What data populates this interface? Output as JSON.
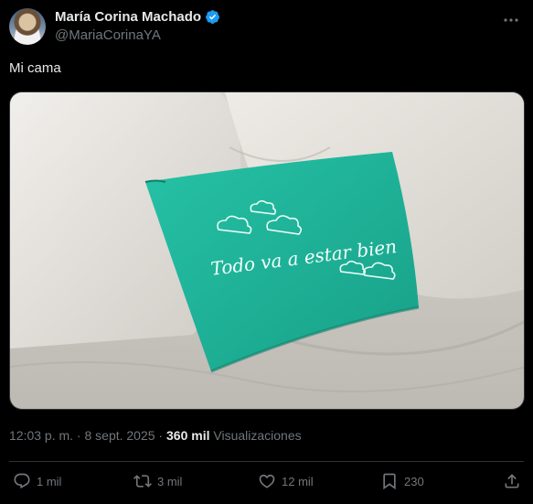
{
  "author": {
    "name": "María Corina Machado",
    "handle": "@MariaCorinaYA",
    "verified": true
  },
  "tweet": {
    "text": "Mi cama",
    "image": {
      "pillow_text": "Todo va a estar bien",
      "pillow_color": "#1fb59a"
    }
  },
  "meta": {
    "timestamp": "12:03 p. m. · 8 sept. 2025 · ",
    "views_count": "360 mil",
    "views_label": " Visualizaciones"
  },
  "actions": {
    "replies": "1 mil",
    "reposts": "3 mil",
    "likes": "12 mil",
    "bookmarks": "230"
  },
  "colors": {
    "background": "#000000",
    "text_primary": "#e7e9ea",
    "text_secondary": "#71767b",
    "verified_blue": "#1d9bf0",
    "divider": "#2f3336"
  },
  "icons": [
    "verified-icon",
    "more-icon",
    "reply-icon",
    "repost-icon",
    "like-icon",
    "bookmark-icon",
    "share-icon"
  ]
}
